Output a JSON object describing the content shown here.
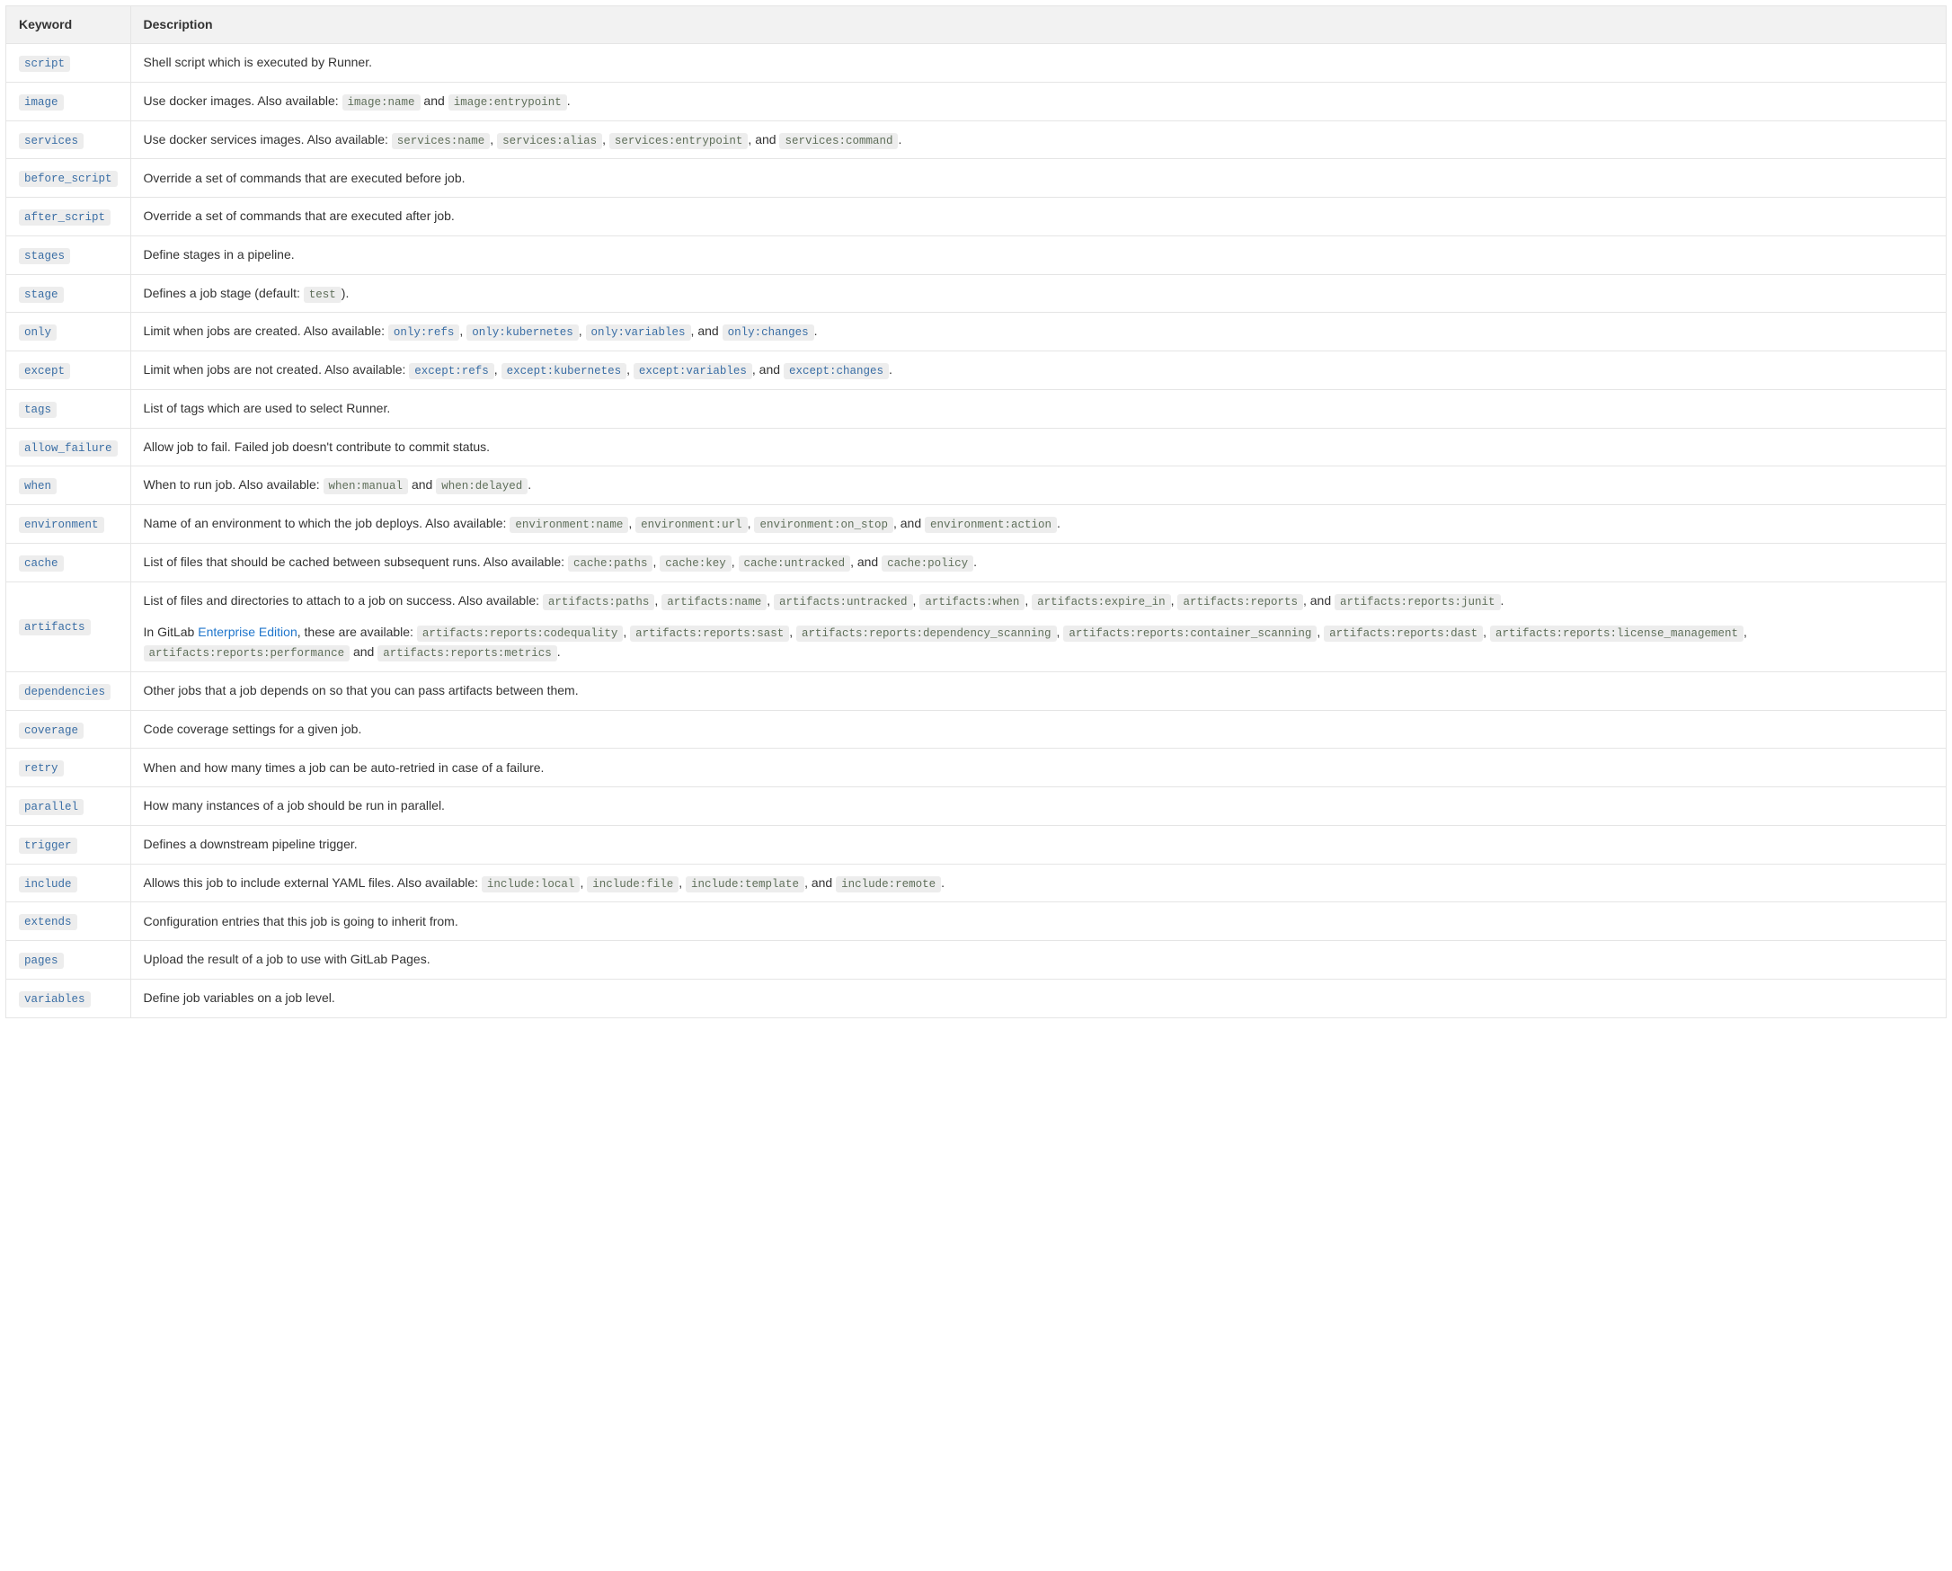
{
  "headers": {
    "keyword": "Keyword",
    "description": "Description"
  },
  "link_text": {
    "enterprise_edition": "Enterprise Edition"
  },
  "rows": [
    {
      "keyword": "script",
      "desc": [
        {
          "segments": [
            {
              "type": "text",
              "text": "Shell script which is executed by Runner."
            }
          ]
        }
      ]
    },
    {
      "keyword": "image",
      "desc": [
        {
          "segments": [
            {
              "type": "text",
              "text": "Use docker images. Also available: "
            },
            {
              "type": "code_muted",
              "text": "image:name"
            },
            {
              "type": "text",
              "text": " and "
            },
            {
              "type": "code_muted",
              "text": "image:entrypoint"
            },
            {
              "type": "text",
              "text": "."
            }
          ]
        }
      ]
    },
    {
      "keyword": "services",
      "desc": [
        {
          "segments": [
            {
              "type": "text",
              "text": "Use docker services images. Also available: "
            },
            {
              "type": "code_muted",
              "text": "services:name"
            },
            {
              "type": "text",
              "text": ", "
            },
            {
              "type": "code_muted",
              "text": "services:alias"
            },
            {
              "type": "text",
              "text": ", "
            },
            {
              "type": "code_muted",
              "text": "services:entrypoint"
            },
            {
              "type": "text",
              "text": ", and "
            },
            {
              "type": "code_muted",
              "text": "services:command"
            },
            {
              "type": "text",
              "text": "."
            }
          ]
        }
      ]
    },
    {
      "keyword": "before_script",
      "desc": [
        {
          "segments": [
            {
              "type": "text",
              "text": "Override a set of commands that are executed before job."
            }
          ]
        }
      ]
    },
    {
      "keyword": "after_script",
      "desc": [
        {
          "segments": [
            {
              "type": "text",
              "text": "Override a set of commands that are executed after job."
            }
          ]
        }
      ]
    },
    {
      "keyword": "stages",
      "desc": [
        {
          "segments": [
            {
              "type": "text",
              "text": "Define stages in a pipeline."
            }
          ]
        }
      ]
    },
    {
      "keyword": "stage",
      "desc": [
        {
          "segments": [
            {
              "type": "text",
              "text": "Defines a job stage (default: "
            },
            {
              "type": "code_muted",
              "text": "test"
            },
            {
              "type": "text",
              "text": ")."
            }
          ]
        }
      ]
    },
    {
      "keyword": "only",
      "desc": [
        {
          "segments": [
            {
              "type": "text",
              "text": "Limit when jobs are created. Also available: "
            },
            {
              "type": "code_ref",
              "text": "only:refs"
            },
            {
              "type": "text",
              "text": ", "
            },
            {
              "type": "code_ref",
              "text": "only:kubernetes"
            },
            {
              "type": "text",
              "text": ", "
            },
            {
              "type": "code_ref",
              "text": "only:variables"
            },
            {
              "type": "text",
              "text": ", and "
            },
            {
              "type": "code_ref",
              "text": "only:changes"
            },
            {
              "type": "text",
              "text": "."
            }
          ]
        }
      ]
    },
    {
      "keyword": "except",
      "desc": [
        {
          "segments": [
            {
              "type": "text",
              "text": "Limit when jobs are not created. Also available: "
            },
            {
              "type": "code_ref",
              "text": "except:refs"
            },
            {
              "type": "text",
              "text": ", "
            },
            {
              "type": "code_ref",
              "text": "except:kubernetes"
            },
            {
              "type": "text",
              "text": ", "
            },
            {
              "type": "code_ref",
              "text": "except:variables"
            },
            {
              "type": "text",
              "text": ", and "
            },
            {
              "type": "code_ref",
              "text": "except:changes"
            },
            {
              "type": "text",
              "text": "."
            }
          ]
        }
      ]
    },
    {
      "keyword": "tags",
      "desc": [
        {
          "segments": [
            {
              "type": "text",
              "text": "List of tags which are used to select Runner."
            }
          ]
        }
      ]
    },
    {
      "keyword": "allow_failure",
      "desc": [
        {
          "segments": [
            {
              "type": "text",
              "text": "Allow job to fail. Failed job doesn't contribute to commit status."
            }
          ]
        }
      ]
    },
    {
      "keyword": "when",
      "desc": [
        {
          "segments": [
            {
              "type": "text",
              "text": "When to run job. Also available: "
            },
            {
              "type": "code_muted",
              "text": "when:manual"
            },
            {
              "type": "text",
              "text": " and "
            },
            {
              "type": "code_muted",
              "text": "when:delayed"
            },
            {
              "type": "text",
              "text": "."
            }
          ]
        }
      ]
    },
    {
      "keyword": "environment",
      "desc": [
        {
          "segments": [
            {
              "type": "text",
              "text": "Name of an environment to which the job deploys. Also available: "
            },
            {
              "type": "code_muted",
              "text": "environment:name"
            },
            {
              "type": "text",
              "text": ", "
            },
            {
              "type": "code_muted",
              "text": "environment:url"
            },
            {
              "type": "text",
              "text": ", "
            },
            {
              "type": "code_muted",
              "text": "environment:on_stop"
            },
            {
              "type": "text",
              "text": ", and "
            },
            {
              "type": "code_muted",
              "text": "environment:action"
            },
            {
              "type": "text",
              "text": "."
            }
          ]
        }
      ]
    },
    {
      "keyword": "cache",
      "desc": [
        {
          "segments": [
            {
              "type": "text",
              "text": "List of files that should be cached between subsequent runs. Also available: "
            },
            {
              "type": "code_muted",
              "text": "cache:paths"
            },
            {
              "type": "text",
              "text": ", "
            },
            {
              "type": "code_muted",
              "text": "cache:key"
            },
            {
              "type": "text",
              "text": ", "
            },
            {
              "type": "code_muted",
              "text": "cache:untracked"
            },
            {
              "type": "text",
              "text": ", and "
            },
            {
              "type": "code_muted",
              "text": "cache:policy"
            },
            {
              "type": "text",
              "text": "."
            }
          ]
        }
      ]
    },
    {
      "keyword": "artifacts",
      "desc": [
        {
          "segments": [
            {
              "type": "text",
              "text": "List of files and directories to attach to a job on success. Also available: "
            },
            {
              "type": "code_muted",
              "text": "artifacts:paths"
            },
            {
              "type": "text",
              "text": ", "
            },
            {
              "type": "code_muted",
              "text": "artifacts:name"
            },
            {
              "type": "text",
              "text": ", "
            },
            {
              "type": "code_muted",
              "text": "artifacts:untracked"
            },
            {
              "type": "text",
              "text": ", "
            },
            {
              "type": "code_muted",
              "text": "artifacts:when"
            },
            {
              "type": "text",
              "text": ", "
            },
            {
              "type": "code_muted",
              "text": "artifacts:expire_in"
            },
            {
              "type": "text",
              "text": ", "
            },
            {
              "type": "code_muted",
              "text": "artifacts:reports"
            },
            {
              "type": "text",
              "text": ", and "
            },
            {
              "type": "code_muted",
              "text": "artifacts:reports:junit"
            },
            {
              "type": "text",
              "text": "."
            }
          ]
        },
        {
          "segments": [
            {
              "type": "text",
              "text": "In GitLab "
            },
            {
              "type": "link",
              "text_key": "link_text.enterprise_edition"
            },
            {
              "type": "text",
              "text": ", these are available: "
            },
            {
              "type": "code_muted",
              "text": "artifacts:reports:codequality"
            },
            {
              "type": "text",
              "text": ", "
            },
            {
              "type": "code_muted",
              "text": "artifacts:reports:sast"
            },
            {
              "type": "text",
              "text": ", "
            },
            {
              "type": "code_muted",
              "text": "artifacts:reports:dependency_scanning"
            },
            {
              "type": "text",
              "text": ", "
            },
            {
              "type": "code_muted",
              "text": "artifacts:reports:container_scanning"
            },
            {
              "type": "text",
              "text": ", "
            },
            {
              "type": "code_muted",
              "text": "artifacts:reports:dast"
            },
            {
              "type": "text",
              "text": ", "
            },
            {
              "type": "code_muted",
              "text": "artifacts:reports:license_management"
            },
            {
              "type": "text",
              "text": ", "
            },
            {
              "type": "code_muted",
              "text": "artifacts:reports:performance"
            },
            {
              "type": "text",
              "text": " and "
            },
            {
              "type": "code_muted",
              "text": "artifacts:reports:metrics"
            },
            {
              "type": "text",
              "text": "."
            }
          ]
        }
      ]
    },
    {
      "keyword": "dependencies",
      "desc": [
        {
          "segments": [
            {
              "type": "text",
              "text": "Other jobs that a job depends on so that you can pass artifacts between them."
            }
          ]
        }
      ]
    },
    {
      "keyword": "coverage",
      "desc": [
        {
          "segments": [
            {
              "type": "text",
              "text": "Code coverage settings for a given job."
            }
          ]
        }
      ]
    },
    {
      "keyword": "retry",
      "desc": [
        {
          "segments": [
            {
              "type": "text",
              "text": "When and how many times a job can be auto-retried in case of a failure."
            }
          ]
        }
      ]
    },
    {
      "keyword": "parallel",
      "desc": [
        {
          "segments": [
            {
              "type": "text",
              "text": "How many instances of a job should be run in parallel."
            }
          ]
        }
      ]
    },
    {
      "keyword": "trigger",
      "desc": [
        {
          "segments": [
            {
              "type": "text",
              "text": "Defines a downstream pipeline trigger."
            }
          ]
        }
      ]
    },
    {
      "keyword": "include",
      "desc": [
        {
          "segments": [
            {
              "type": "text",
              "text": "Allows this job to include external YAML files. Also available: "
            },
            {
              "type": "code_muted",
              "text": "include:local"
            },
            {
              "type": "text",
              "text": ", "
            },
            {
              "type": "code_muted",
              "text": "include:file"
            },
            {
              "type": "text",
              "text": ", "
            },
            {
              "type": "code_muted",
              "text": "include:template"
            },
            {
              "type": "text",
              "text": ", and "
            },
            {
              "type": "code_muted",
              "text": "include:remote"
            },
            {
              "type": "text",
              "text": "."
            }
          ]
        }
      ]
    },
    {
      "keyword": "extends",
      "desc": [
        {
          "segments": [
            {
              "type": "text",
              "text": "Configuration entries that this job is going to inherit from."
            }
          ]
        }
      ]
    },
    {
      "keyword": "pages",
      "desc": [
        {
          "segments": [
            {
              "type": "text",
              "text": "Upload the result of a job to use with GitLab Pages."
            }
          ]
        }
      ]
    },
    {
      "keyword": "variables",
      "desc": [
        {
          "segments": [
            {
              "type": "text",
              "text": "Define job variables on a job level."
            }
          ]
        }
      ]
    }
  ]
}
